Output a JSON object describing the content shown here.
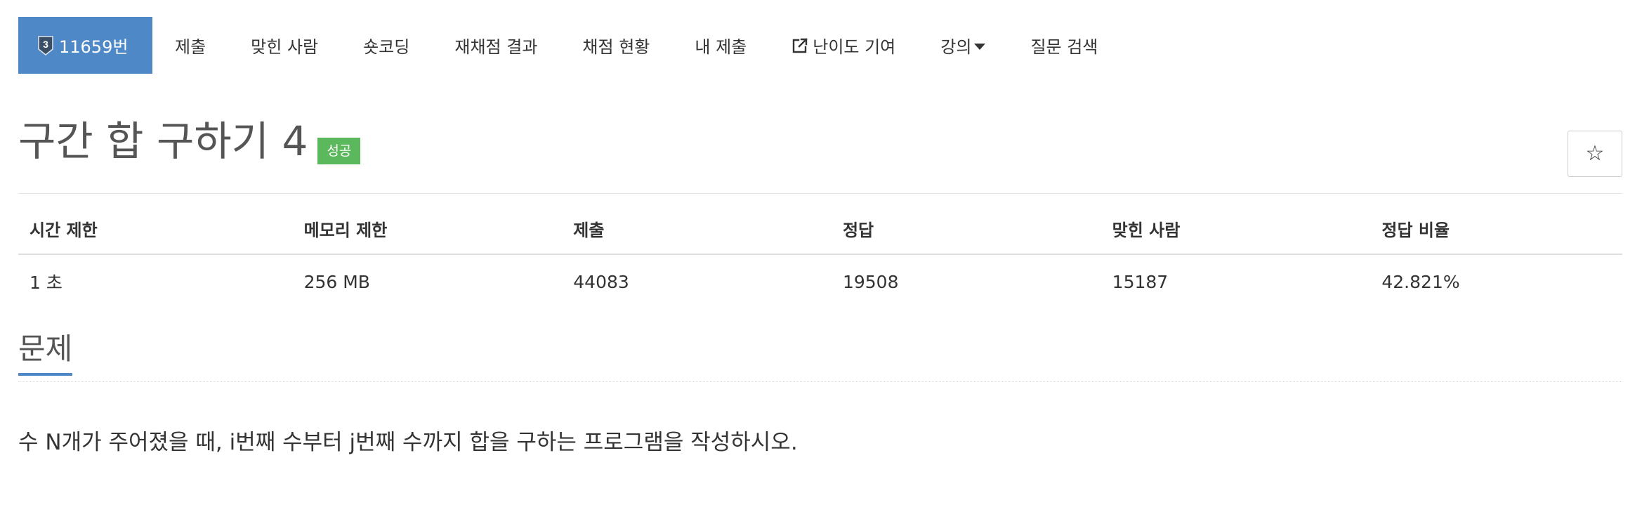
{
  "nav": {
    "items": [
      {
        "label": "11659번",
        "tier": "3"
      },
      {
        "label": "제출"
      },
      {
        "label": "맞힌 사람"
      },
      {
        "label": "숏코딩"
      },
      {
        "label": "재채점 결과"
      },
      {
        "label": "채점 현황"
      },
      {
        "label": "내 제출"
      },
      {
        "label": "난이도 기여"
      },
      {
        "label": "강의"
      },
      {
        "label": "질문 검색"
      }
    ]
  },
  "problem": {
    "title": "구간 합 구하기 4",
    "status": "성공",
    "star": "☆"
  },
  "info_table": {
    "headers": [
      "시간 제한",
      "메모리 제한",
      "제출",
      "정답",
      "맞힌 사람",
      "정답 비율"
    ],
    "values": [
      "1 초",
      "256 MB",
      "44083",
      "19508",
      "15187",
      "42.821%"
    ]
  },
  "section": {
    "heading": "문제",
    "text": "수 N개가 주어졌을 때, i번째 수부터 j번째 수까지 합을 구하는 프로그램을 작성하시오."
  },
  "colors": {
    "accent": "#4f88c6",
    "success": "#5cb85c"
  }
}
